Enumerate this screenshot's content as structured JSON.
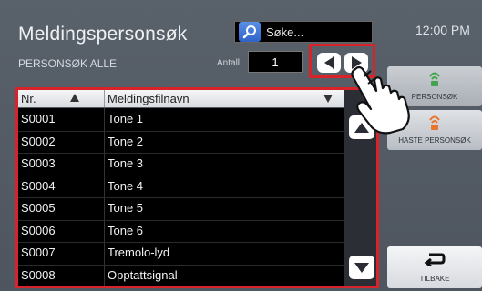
{
  "header": {
    "title": "Meldingspersonsøk",
    "subtitle": "PERSONSØK ALLE",
    "search_placeholder": "Søke...",
    "clock": "12:00 PM"
  },
  "counter": {
    "label": "Antall",
    "value": "1"
  },
  "list": {
    "columns": [
      "Nr.",
      "Meldingsfilnavn"
    ],
    "rows": [
      {
        "nr": "S0001",
        "name": "Tone 1"
      },
      {
        "nr": "S0002",
        "name": "Tone 2"
      },
      {
        "nr": "S0003",
        "name": "Tone 3"
      },
      {
        "nr": "S0004",
        "name": "Tone 4"
      },
      {
        "nr": "S0005",
        "name": "Tone 5"
      },
      {
        "nr": "S0006",
        "name": "Tone 6"
      },
      {
        "nr": "S0007",
        "name": "Tremolo-lyd"
      },
      {
        "nr": "S0008",
        "name": "Opptattsignal"
      }
    ]
  },
  "side_buttons": {
    "page": "PERSONSØK",
    "urgent_page": "HASTE PERSONSØK",
    "back": "TILBAKE"
  },
  "colors": {
    "highlight": "#d8232a",
    "icon_green": "#3fb24a",
    "icon_orange": "#e9742b"
  }
}
